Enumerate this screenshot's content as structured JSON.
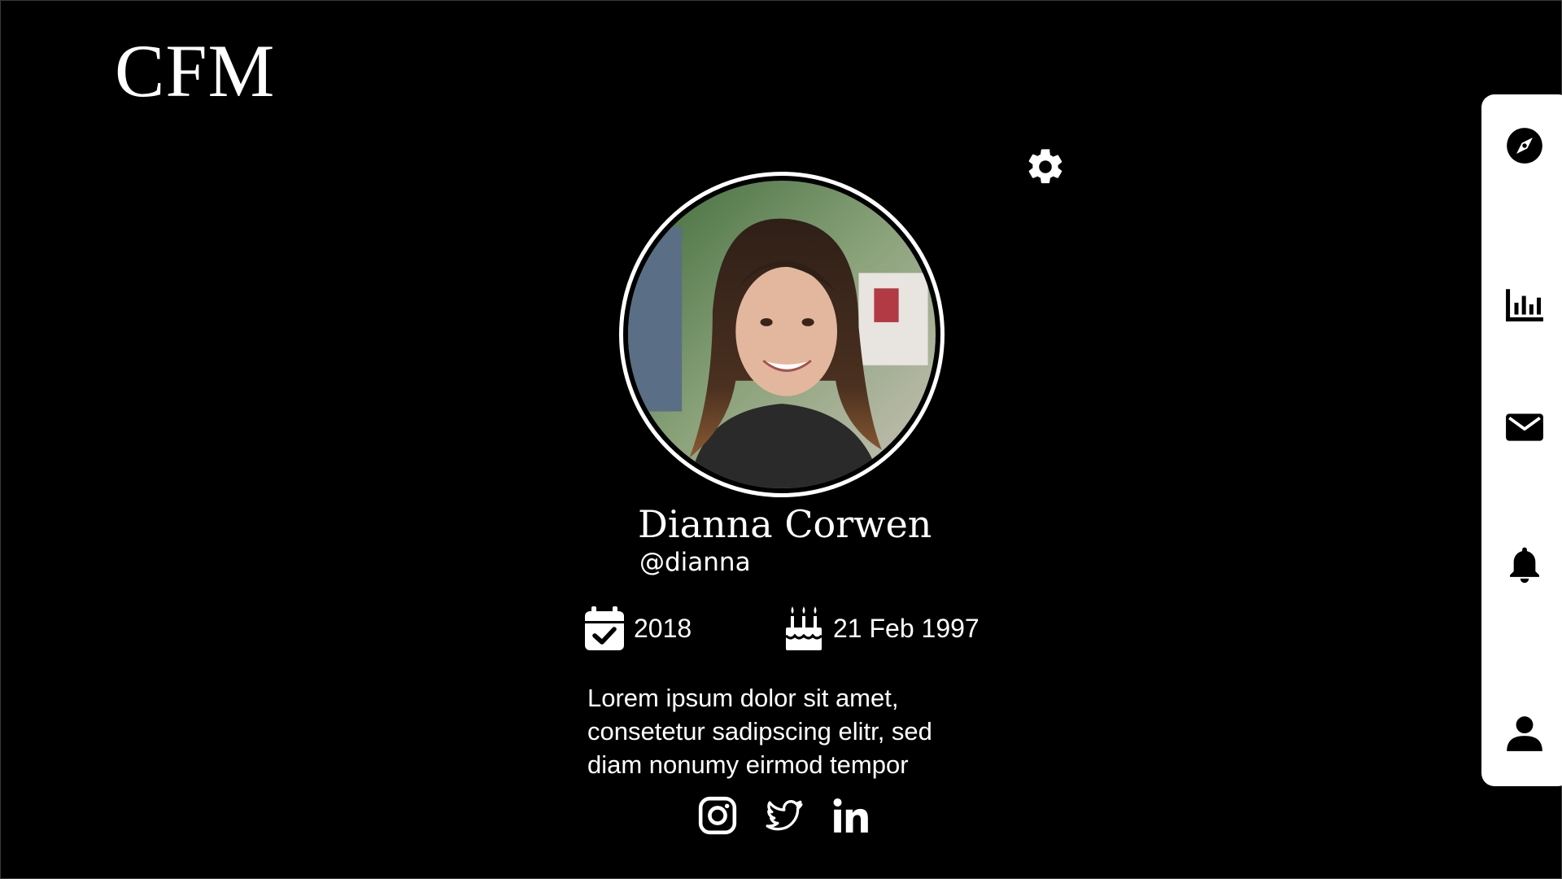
{
  "brand": {
    "logo_text": "CFM"
  },
  "header": {
    "settings_icon": "gear-icon"
  },
  "profile": {
    "name": "Dianna Corwen",
    "handle": "@dianna",
    "joined_year": "2018",
    "birthday": "21 Feb 1997",
    "bio_lines": [
      "Lorem ipsum dolor sit amet,",
      "consetetur sadipscing elitr, sed",
      "diam nonumy eirmod tempor"
    ]
  },
  "socials": [
    {
      "name": "instagram",
      "icon": "instagram-icon"
    },
    {
      "name": "twitter",
      "icon": "twitter-icon"
    },
    {
      "name": "linkedin",
      "icon": "linkedin-icon"
    }
  ],
  "sidebar": {
    "items": [
      {
        "name": "explore",
        "icon": "compass-icon"
      },
      {
        "name": "stats",
        "icon": "bar-chart-icon"
      },
      {
        "name": "messages",
        "icon": "envelope-icon"
      },
      {
        "name": "notifications",
        "icon": "bell-icon"
      },
      {
        "name": "profile",
        "icon": "user-icon"
      }
    ]
  },
  "colors": {
    "background": "#000000",
    "foreground": "#ffffff",
    "sidebar": "#ffffff",
    "sidebar_icons": "#000000"
  }
}
